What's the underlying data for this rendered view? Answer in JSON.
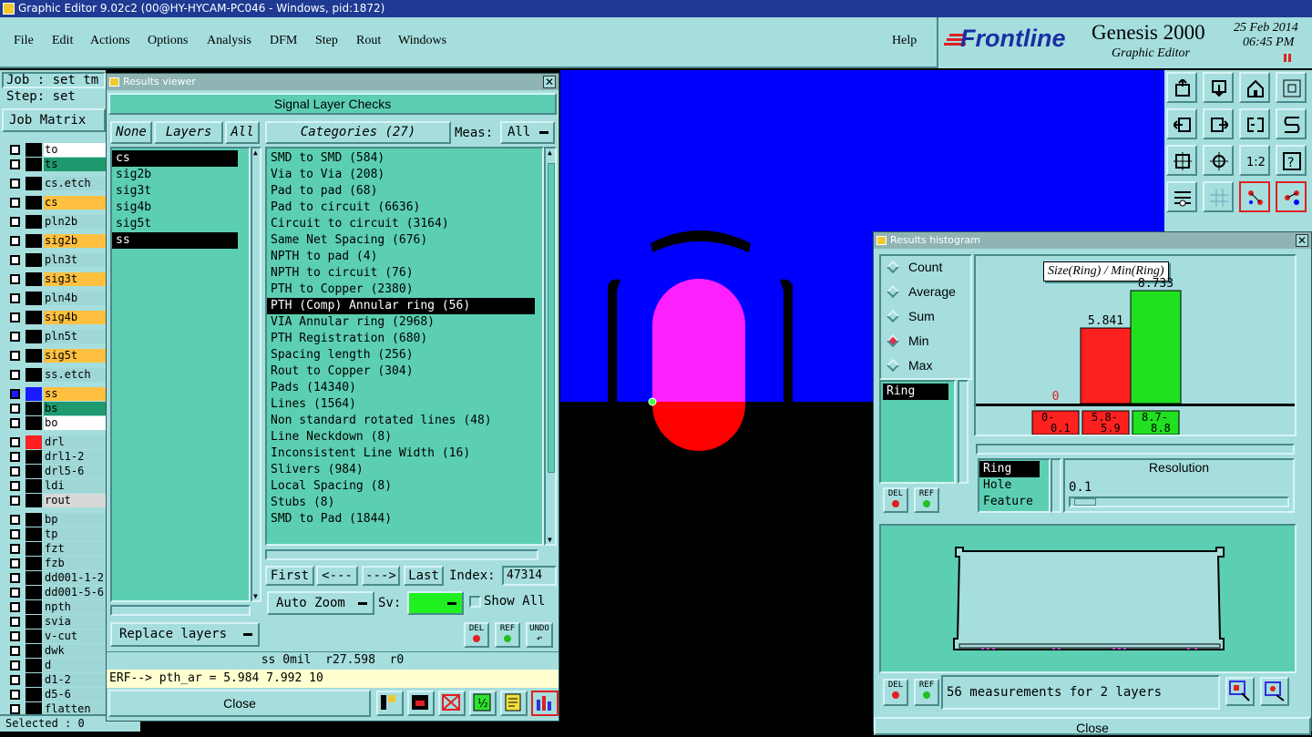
{
  "window": {
    "title": "Graphic Editor 9.02c2 (00@HY-HYCAM-PC046 - Windows, pid:1872)"
  },
  "menu": {
    "items": [
      "File",
      "Edit",
      "Actions",
      "Options",
      "Analysis",
      "DFM",
      "Step",
      "Rout",
      "Windows"
    ],
    "help": "Help"
  },
  "brand": {
    "logo": "Frontline",
    "product": "Genesis 2000",
    "subtitle": "Graphic Editor",
    "date": "25 Feb 2014",
    "time": "06:45 PM"
  },
  "left": {
    "job": "Job : set_tm",
    "step": "Step: set",
    "job_matrix": "Job Matrix",
    "selected": "Selected : 0",
    "layers": [
      {
        "name": "to",
        "color": "#ffffff"
      },
      {
        "name": "ts",
        "color": "#1e9a6e"
      },
      {
        "name": "cs.etch",
        "color": "#9fd6d6"
      },
      {
        "name": "cs",
        "color": "#ffc040"
      },
      {
        "name": "pln2b",
        "color": "#9fd6d6"
      },
      {
        "name": "sig2b",
        "color": "#ffc040"
      },
      {
        "name": "pln3t",
        "color": "#9fd6d6"
      },
      {
        "name": "sig3t",
        "color": "#ffc040"
      },
      {
        "name": "pln4b",
        "color": "#9fd6d6"
      },
      {
        "name": "sig4b",
        "color": "#ffc040"
      },
      {
        "name": "pln5t",
        "color": "#9fd6d6"
      },
      {
        "name": "sig5t",
        "color": "#ffc040"
      },
      {
        "name": "ss.etch",
        "color": "#9fd6d6"
      },
      {
        "name": "ss",
        "color": "#ffc040"
      },
      {
        "name": "bs",
        "color": "#1e9a6e"
      },
      {
        "name": "bo",
        "color": "#ffffff"
      },
      {
        "name": "drl",
        "color": "#9fd6d6"
      },
      {
        "name": "drl1-2",
        "color": "#9fd6d6"
      },
      {
        "name": "drl5-6",
        "color": "#9fd6d6"
      },
      {
        "name": "ldi",
        "color": "#9fd6d6"
      },
      {
        "name": "rout",
        "color": "#d8d8d8"
      },
      {
        "name": "bp",
        "color": "#9fd6d6"
      },
      {
        "name": "tp",
        "color": "#9fd6d6"
      },
      {
        "name": "fzt",
        "color": "#9fd6d6"
      },
      {
        "name": "fzb",
        "color": "#9fd6d6"
      },
      {
        "name": "dd001-1-2",
        "color": "#9fd6d6"
      },
      {
        "name": "dd001-5-6",
        "color": "#9fd6d6"
      },
      {
        "name": "npth",
        "color": "#9fd6d6"
      },
      {
        "name": "svia",
        "color": "#9fd6d6"
      },
      {
        "name": "v-cut",
        "color": "#9fd6d6"
      },
      {
        "name": "dwk",
        "color": "#9fd6d6"
      },
      {
        "name": "d",
        "color": "#9fd6d6"
      },
      {
        "name": "d1-2",
        "color": "#9fd6d6"
      },
      {
        "name": "d5-6",
        "color": "#9fd6d6"
      },
      {
        "name": "flatten",
        "color": "#9fd6d6"
      }
    ]
  },
  "results_viewer": {
    "title": "Results viewer",
    "heading": "Signal Layer Checks",
    "none_btn": "None",
    "layers_btn": "Layers",
    "all_btn": "All",
    "layers": [
      {
        "name": "cs",
        "selected": true
      },
      {
        "name": "sig2b",
        "selected": false
      },
      {
        "name": "sig3t",
        "selected": false
      },
      {
        "name": "sig4b",
        "selected": false
      },
      {
        "name": "sig5t",
        "selected": false
      },
      {
        "name": "ss",
        "selected": true
      }
    ],
    "categories_btn": "Categories (27)",
    "meas_label": "Meas:",
    "meas_value": "All",
    "categories": [
      {
        "label": "SMD to SMD (584)",
        "selected": false
      },
      {
        "label": "Via to Via (208)",
        "selected": false
      },
      {
        "label": "Pad to pad (68)",
        "selected": false
      },
      {
        "label": "Pad to circuit (6636)",
        "selected": false
      },
      {
        "label": "Circuit to circuit (3164)",
        "selected": false
      },
      {
        "label": "Same Net Spacing (676)",
        "selected": false
      },
      {
        "label": "NPTH to pad (4)",
        "selected": false
      },
      {
        "label": "NPTH to circuit (76)",
        "selected": false
      },
      {
        "label": "PTH to Copper (2380)",
        "selected": false
      },
      {
        "label": "PTH (Comp) Annular ring (56)",
        "selected": true
      },
      {
        "label": "VIA Annular ring (2968)",
        "selected": false
      },
      {
        "label": "PTH Registration (680)",
        "selected": false
      },
      {
        "label": "Spacing length (256)",
        "selected": false
      },
      {
        "label": "Rout to Copper (304)",
        "selected": false
      },
      {
        "label": "Pads (14340)",
        "selected": false
      },
      {
        "label": "Lines (1564)",
        "selected": false
      },
      {
        "label": "Non standard rotated lines (48)",
        "selected": false
      },
      {
        "label": "Line Neckdown (8)",
        "selected": false
      },
      {
        "label": "Inconsistent Line Width (16)",
        "selected": false
      },
      {
        "label": "Slivers (984)",
        "selected": false
      },
      {
        "label": "Local Spacing (8)",
        "selected": false
      },
      {
        "label": "Stubs (8)",
        "selected": false
      },
      {
        "label": "SMD to Pad (1844)",
        "selected": false
      }
    ],
    "nav": {
      "first": "First",
      "prev": "<---",
      "next": "--->",
      "last": "Last",
      "index_label": "Index:",
      "index_value": "47314"
    },
    "auto_zoom": "Auto Zoom",
    "sv_label": "Sv:",
    "show_all": "Show All",
    "replace_layers": "Replace layers",
    "del": "DEL",
    "ref": "REF",
    "undo": "UNDO",
    "status": "ss 0mil  r27.598  r0",
    "erf": "ERF--> pth_ar = 5.984 7.992 10",
    "close": "Close"
  },
  "histogram": {
    "title": "Results histogram",
    "modes": [
      {
        "label": "Count",
        "on": false
      },
      {
        "label": "Average",
        "on": false
      },
      {
        "label": "Sum",
        "on": false
      },
      {
        "label": "Min",
        "on": true
      },
      {
        "label": "Max",
        "on": false
      }
    ],
    "selected_item": "Ring",
    "chart_title": "Size(Ring) / Min(Ring)",
    "bars": [
      {
        "label": "0",
        "bin": "0-\n0.1",
        "value": 0,
        "color": "#ff2020"
      },
      {
        "label": "5.841",
        "bin": "5.8-\n5.9",
        "value": 5.841,
        "color": "#ff2020"
      },
      {
        "label": "8.733",
        "bin": "8.7-\n8.8",
        "value": 8.733,
        "color": "#20e020"
      }
    ],
    "feature_list": [
      {
        "name": "Ring",
        "selected": true
      },
      {
        "name": "Hole",
        "selected": false
      },
      {
        "name": "Feature",
        "selected": false
      }
    ],
    "resolution_label": "Resolution",
    "resolution_value": "0.1",
    "summary": "56 measurements for 2 layers",
    "del": "DEL",
    "ref": "REF",
    "close": "Close"
  }
}
